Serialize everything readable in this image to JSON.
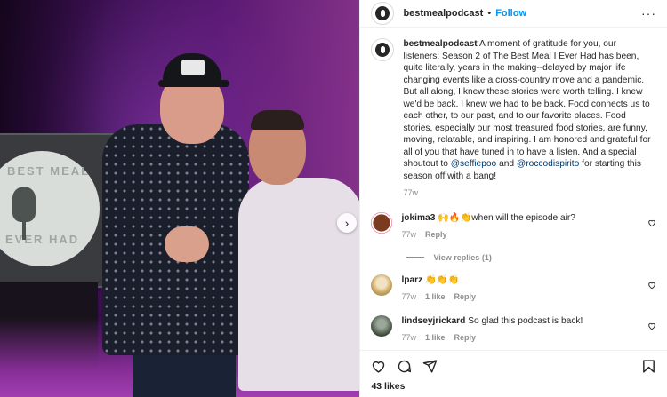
{
  "header": {
    "username": "bestmealpodcast",
    "separator": "•",
    "follow_label": "Follow",
    "more_label": "···"
  },
  "photo": {
    "logo_line1": "BEST MEAL",
    "logo_line2": "EVER HAD",
    "next_glyph": "›"
  },
  "caption": {
    "username": "bestmealpodcast",
    "text_before": "A moment of gratitude for you, our listeners: Season 2 of The Best Meal I Ever Had has been, quite literally, years in the making--delayed by major life changing events like a cross-country move and a pandemic. But all along, I knew these stories were worth telling. I knew we'd be back. I knew we had to be back. Food connects us to each other, to our past, and to our favorite places. Food stories, especially our most treasured food stories, are funny, moving, relatable, and inspiring. I am honored and grateful for all of you that have tuned in to have a listen. And a special shoutout to",
    "mention1": "@seffiepoo",
    "and": "and",
    "mention2": "@roccodispirito",
    "text_after": "for starting this season off with a bang!",
    "time": "77w"
  },
  "comments": [
    {
      "username": "jokima3",
      "text": "🙌🔥👏when will the episode air?",
      "time": "77w",
      "likes": "",
      "reply_label": "Reply",
      "avatar_color": "#7a3b20"
    },
    {
      "username": "lparz",
      "text": "👏👏👏",
      "time": "77w",
      "likes": "1 like",
      "reply_label": "Reply",
      "avatar_color": "#c9a25a"
    },
    {
      "username": "lindseyjrickard",
      "text": "So glad this podcast is back!",
      "time": "77w",
      "likes": "1 like",
      "reply_label": "Reply",
      "avatar_color": "#3d4a3a"
    }
  ],
  "view_replies": "View replies (1)",
  "likes_count": "43 likes",
  "colors": {
    "follow_blue": "#0095f6",
    "mention_blue": "#00376b",
    "meta_gray": "#8e8e8e"
  },
  "icons": [
    "heart-icon",
    "comment-icon",
    "share-icon",
    "bookmark-icon",
    "chevron-right-icon"
  ]
}
